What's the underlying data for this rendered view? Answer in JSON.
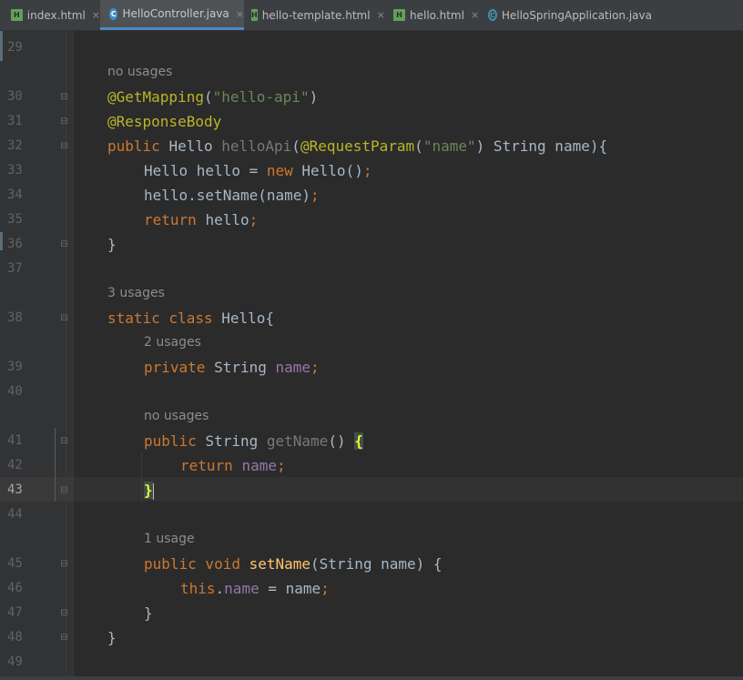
{
  "tabs": [
    {
      "label": "index.html",
      "icon": "html-file-icon",
      "icon_text": "H",
      "active": false
    },
    {
      "label": "HelloController.java",
      "icon": "java-class-icon",
      "icon_text": "C",
      "active": true
    },
    {
      "label": "hello-template.html",
      "icon": "html-file-icon",
      "icon_text": "H",
      "active": false
    },
    {
      "label": "hello.html",
      "icon": "html-file-icon",
      "icon_text": "H",
      "active": false
    },
    {
      "label": "HelloSpringApplication.java",
      "icon": "spring-app-icon",
      "icon_text": "C",
      "active": false
    }
  ],
  "close_glyph": "×",
  "line_numbers": [
    "29",
    "30",
    "31",
    "32",
    "33",
    "34",
    "35",
    "36",
    "37",
    "38",
    "39",
    "40",
    "41",
    "42",
    "43",
    "44",
    "45",
    "46",
    "47",
    "48",
    "49"
  ],
  "current_line": "43",
  "hints": {
    "no_usages_1": "no usages",
    "usages_3": "3 usages",
    "usages_2": "2 usages",
    "no_usages_2": "no usages",
    "usages_1": "1 usage"
  },
  "code": {
    "l30": {
      "ann": "@GetMapping",
      "p1": "(",
      "str": "\"hello-api\"",
      "p2": ")"
    },
    "l31": {
      "ann": "@ResponseBody"
    },
    "l32": {
      "kw": "public ",
      "t1": "Hello ",
      "method": "helloApi",
      "p1": "(",
      "ann": "@RequestParam",
      "p2": "(",
      "str": "\"name\"",
      "p3": ") String name){"
    },
    "l33": {
      "t1": "Hello hello = ",
      "kw": "new ",
      "t2": "Hello()",
      "semi": ";"
    },
    "l34": {
      "t1": "hello.setName(name)",
      "semi": ";"
    },
    "l35": {
      "kw": "return ",
      "t1": "hello",
      "semi": ";"
    },
    "l36": {
      "t1": "}"
    },
    "l38": {
      "kw": "static class ",
      "t1": "Hello{"
    },
    "l39": {
      "kw": "private ",
      "t1": "String ",
      "field": "name",
      "semi": ";"
    },
    "l41": {
      "kw": "public ",
      "t1": "String ",
      "method": "getName",
      "t2": "() ",
      "brace": "{"
    },
    "l42": {
      "kw": "return ",
      "field": "name",
      "semi": ";"
    },
    "l43": {
      "brace": "}"
    },
    "l45": {
      "kw": "public void ",
      "fn": "setName",
      "t1": "(String name) {"
    },
    "l46": {
      "kw": "this",
      "dot": ".",
      "field": "name",
      "t1": " = name",
      "semi": ";"
    },
    "l47": {
      "t1": "}"
    },
    "l48": {
      "t1": "}"
    }
  }
}
